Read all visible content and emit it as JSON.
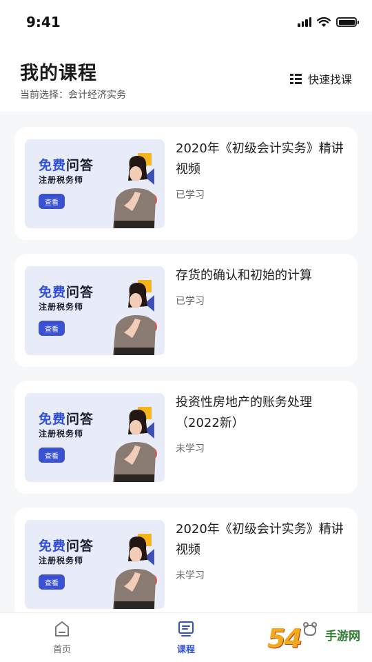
{
  "status_bar": {
    "time": "9:41"
  },
  "header": {
    "title": "我的课程",
    "subtitle": "当前选择：会计经济实务",
    "quick_find_label": "快速找课"
  },
  "thumbnail": {
    "free_part1": "免费",
    "free_part2": "问答",
    "subtitle": "注册税务师",
    "button": "查看"
  },
  "courses": [
    {
      "title": "2020年《初级会计实务》精讲视频",
      "status": "已学习"
    },
    {
      "title": "存货的确认和初始的计算",
      "status": "已学习"
    },
    {
      "title": "投资性房地产的账务处理（2022新）",
      "status": "未学习"
    },
    {
      "title": "2020年《初级会计实务》精讲视频",
      "status": "未学习"
    }
  ],
  "tabbar": {
    "home_label": "首页",
    "course_label": "课程"
  },
  "colors": {
    "accent": "#2f4fd6",
    "thumb_bg": "#e7ecf8"
  },
  "watermark": {
    "digits": "54",
    "text": "手游网"
  }
}
